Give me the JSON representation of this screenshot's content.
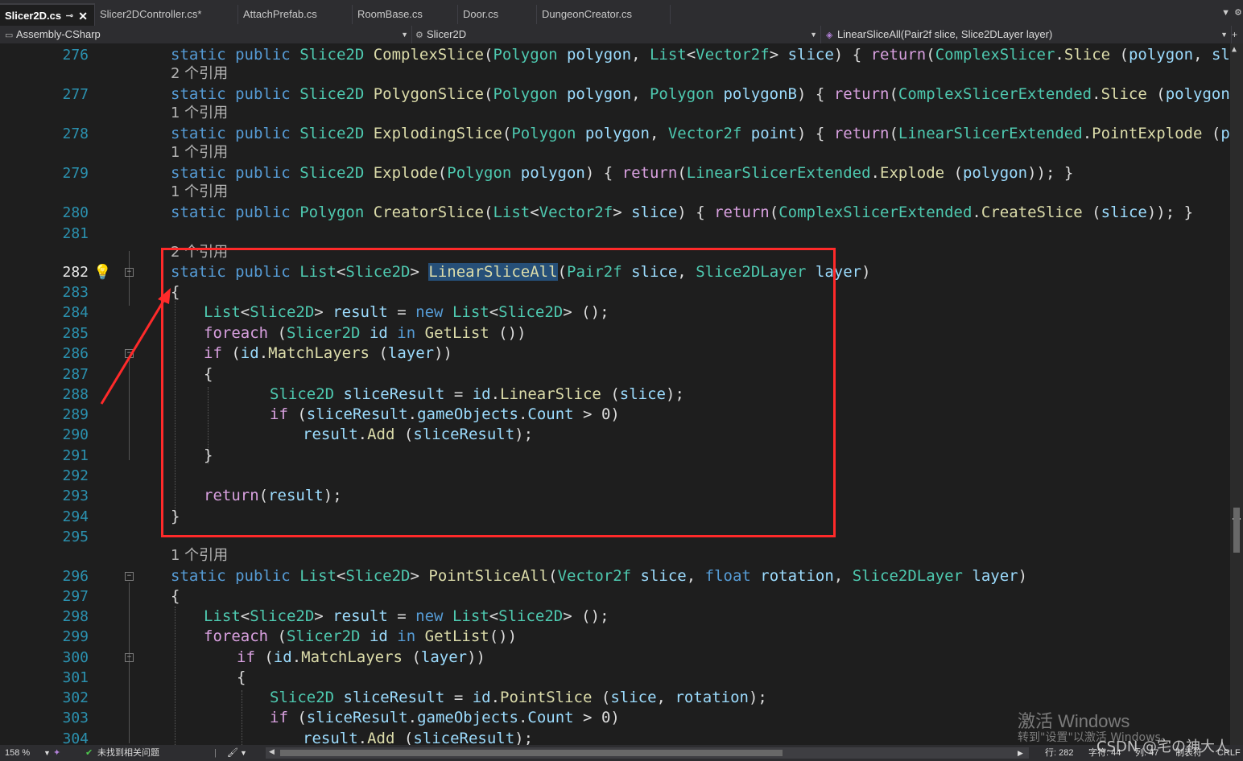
{
  "tabs": [
    {
      "label": "Slicer2D.cs",
      "active": true,
      "pin": "⊸",
      "close": "✕"
    },
    {
      "label": "Slicer2DController.cs*",
      "active": false
    },
    {
      "label": "AttachPrefab.cs",
      "active": false
    },
    {
      "label": "RoomBase.cs",
      "active": false
    },
    {
      "label": "Door.cs",
      "active": false
    },
    {
      "label": "DungeonCreator.cs",
      "active": false
    }
  ],
  "tab_overflow_icon": "dropdown-icon",
  "settings_icon": "gear-icon",
  "navbar": {
    "project": "Assembly-CSharp",
    "type": "Slicer2D",
    "member": "LinearSliceAll(Pair2f slice, Slice2DLayer layer)"
  },
  "codelens": {
    "refs1": "1 个引用",
    "refs2": "2 个引用"
  },
  "line_numbers": {
    "l276": "276",
    "l277": "277",
    "l278": "278",
    "l279": "279",
    "l280": "280",
    "l281": "281",
    "l282": "282",
    "l283": "283",
    "l284": "284",
    "l285": "285",
    "l286": "286",
    "l287": "287",
    "l288": "288",
    "l289": "289",
    "l290": "290",
    "l291": "291",
    "l292": "292",
    "l293": "293",
    "l294": "294",
    "l295": "295",
    "l296": "296",
    "l297": "297",
    "l298": "298",
    "l299": "299",
    "l300": "300",
    "l301": "301",
    "l302": "302",
    "l303": "303",
    "l304": "304"
  },
  "tokens": {
    "static": "static",
    "public": "public",
    "return": "return",
    "new": "new",
    "foreach": "foreach",
    "in": "in",
    "if": "if",
    "float": "float",
    "Slice2D": "Slice2D",
    "Polygon": "Polygon",
    "List": "List",
    "Vector2f": "Vector2f",
    "Pair2f": "Pair2f",
    "Slice2DLayer": "Slice2DLayer",
    "Slicer2D": "Slicer2D",
    "ComplexSlicer": "ComplexSlicer",
    "ComplexSlicerExtended": "ComplexSlicerExtended",
    "LinearSlicerExtended": "LinearSlicerExtended",
    "ComplexSlice": "ComplexSlice",
    "PolygonSlice": "PolygonSlice",
    "ExplodingSlice": "ExplodingSlice",
    "Explode": "Explode",
    "CreatorSlice": "CreatorSlice",
    "LinearSliceAll": "LinearSliceAll",
    "PointSliceAll": "PointSliceAll",
    "Slice": "Slice",
    "PointExplode": "PointExplode",
    "CreateSlice": "CreateSlice",
    "GetList": "GetList",
    "MatchLayers": "MatchLayers",
    "LinearSlice": "LinearSlice",
    "PointSlice": "PointSlice",
    "Add": "Add",
    "polygon": "polygon",
    "polygonB": "polygonB",
    "slice": "slice",
    "point": "point",
    "layer": "layer",
    "result": "result",
    "id": "id",
    "sliceResult": "sliceResult",
    "rotation": "rotation",
    "gameObjects": "gameObjects",
    "Count": "Count",
    "lt": "<",
    "gt": ">",
    "lp": "(",
    "rp": ")",
    "sp": " ",
    "comma": ", ",
    "dot": ".",
    "semi": ";",
    "lb": "{",
    "rb": "}",
    "eq": " = ",
    "zero": "0",
    "end_return_close": "); }",
    "end_return_close2": ")); }",
    "end_return_close3": "));"
  },
  "statusbar": {
    "zoom": "158 %",
    "issues": "未找到相关问题",
    "line": "行: 282",
    "char": "字符: 44",
    "col": "列: 47",
    "tabs": "制表符",
    "eol": "CRLF"
  },
  "watermark": {
    "activate": "激活 Windows",
    "goto": "转到\"设置\"以激活 Windows。",
    "csdn": "CSDN @宅の神大人"
  },
  "annotation_color": "#ff2a2a"
}
